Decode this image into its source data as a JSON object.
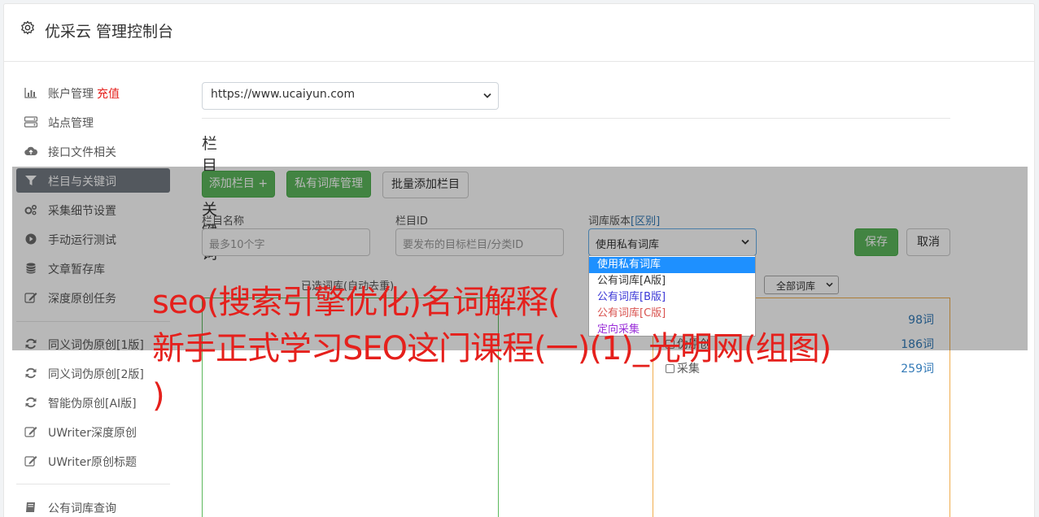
{
  "header": {
    "title": "优采云 管理控制台"
  },
  "sidebar": {
    "items": [
      {
        "label": "账户管理",
        "extra": "充值",
        "icon": "bar-chart-icon"
      },
      {
        "label": "站点管理",
        "icon": "server-icon"
      },
      {
        "label": "接口文件相关",
        "icon": "cloud-upload-icon"
      },
      {
        "label": "栏目与关键词",
        "icon": "filter-icon",
        "active": true
      },
      {
        "label": "采集细节设置",
        "icon": "gears-icon"
      },
      {
        "label": "手动运行测试",
        "icon": "play-icon"
      },
      {
        "label": "文章暂存库",
        "icon": "database-icon"
      },
      {
        "label": "深度原创任务",
        "icon": "edit-icon"
      },
      {
        "label": "同义词伪原创[1版]",
        "icon": "refresh-icon"
      },
      {
        "label": "同义词伪原创[2版]",
        "icon": "refresh-icon"
      },
      {
        "label": "智能伪原创[AI版]",
        "icon": "refresh-icon"
      },
      {
        "label": "UWriter深度原创",
        "icon": "edit-icon"
      },
      {
        "label": "UWriter原创标题",
        "icon": "edit-icon"
      },
      {
        "label": "公有词库查询",
        "icon": "book-icon"
      }
    ]
  },
  "site_select": {
    "value": "https://www.ucaiyun.com"
  },
  "section_title": "栏目与关键词",
  "toolbar": {
    "add_column": "添加栏目 +",
    "private_lexicon": "私有词库管理",
    "batch_add": "批量添加栏目"
  },
  "form": {
    "column_name_label": "栏目名称",
    "column_name_placeholder": "最多10个字",
    "column_id_label": "栏目ID",
    "column_id_placeholder": "要发布的目标栏目/分类ID",
    "lexicon_version_label": "词库版本",
    "lexicon_version_link": "[区别]",
    "lexicon_version_value": "使用私有词库",
    "save": "保存",
    "cancel": "取消"
  },
  "dropdown_options": [
    {
      "label": "使用私有词库",
      "color": "#ffffff",
      "selected": true
    },
    {
      "label": "公有词库[A版]",
      "color": "#333333"
    },
    {
      "label": "公有词库[B版]",
      "color": "#3b37d6"
    },
    {
      "label": "公有词库[C版]",
      "color": "#d9534f"
    },
    {
      "label": "定向采集",
      "color": "#9b30d9"
    }
  ],
  "lexicon_filter": {
    "value": "全部词库"
  },
  "selected_words_label": "已选词库(自动去重)",
  "lexicon_rows": [
    {
      "name": "",
      "count": "98词"
    },
    {
      "name": "伪原创",
      "count": "186词"
    },
    {
      "name": "采集",
      "count": "259词"
    }
  ],
  "watermark": {
    "line1": "seo(搜索引擎优化)名词解释(",
    "line2": "新手正式学习SEO这门课程(一)(1)_光明网(组图)",
    "line3": ")"
  }
}
